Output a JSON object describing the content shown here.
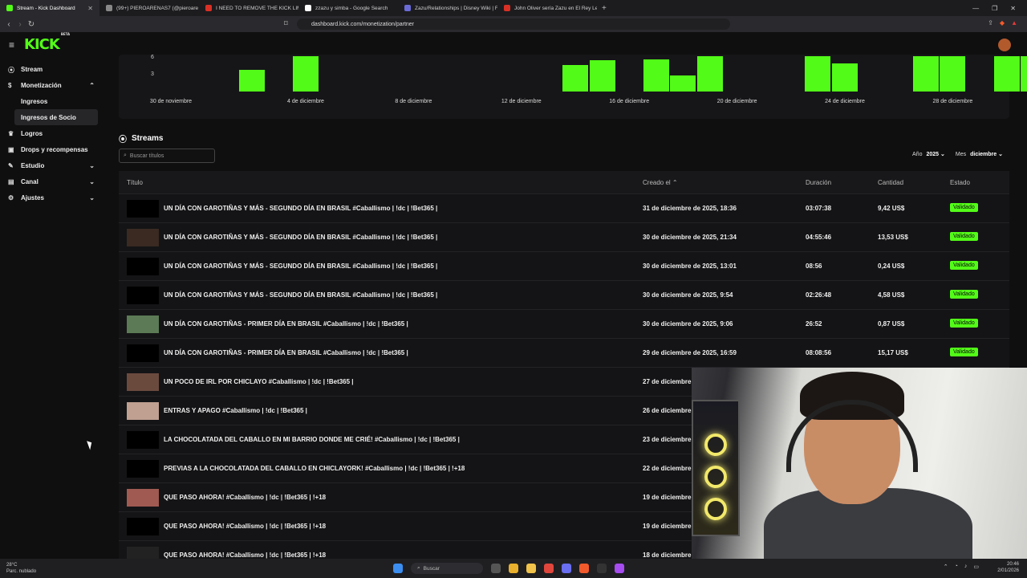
{
  "browser": {
    "tabs": [
      {
        "label": "Stream - Kick Dashboard",
        "color": "#53fc18",
        "active": true
      },
      {
        "label": "(99+) PIEROARENAS7 (@pieroare",
        "color": "#888888"
      },
      {
        "label": "I NEED TO REMOVE THE KICK LIMITI",
        "color": "#d93025"
      },
      {
        "label": "zzazu y simba - Google Search",
        "color": "#ffffff"
      },
      {
        "label": "Zazu/Relationships | Disney Wiki | Fa",
        "color": "#6b6bd6"
      },
      {
        "label": "John Oliver sería Zazu en El Rey León",
        "color": "#d93025"
      }
    ],
    "new_tab": "+",
    "url": "dashboard.kick.com/monetization/partner"
  },
  "brand": {
    "logo": "KICK",
    "beta": "BETA"
  },
  "sidebar": {
    "items": [
      {
        "label": "Stream",
        "icon": "broadcast-icon"
      },
      {
        "label": "Monetización",
        "icon": "dollar-icon",
        "expanded": true
      },
      {
        "label": "Logros",
        "icon": "trophy-icon"
      },
      {
        "label": "Drops y recompensas",
        "icon": "gift-icon"
      },
      {
        "label": "Estudio",
        "icon": "pencil-icon"
      },
      {
        "label": "Canal",
        "icon": "channel-icon"
      },
      {
        "label": "Ajustes",
        "icon": "gear-icon"
      }
    ],
    "sub_items": [
      {
        "label": "Ingresos"
      },
      {
        "label": "Ingresos de Socio",
        "active": true
      }
    ]
  },
  "chart_data": {
    "type": "bar",
    "y_ticks": [
      "6",
      "3"
    ],
    "x_labels": [
      "30 de noviembre",
      "4 de diciembre",
      "8 de diciembre",
      "12 de diciembre",
      "16 de diciembre",
      "20 de diciembre",
      "24 de diciembre",
      "28 de diciembre"
    ],
    "bar_color": "#53fc18",
    "bars": [
      {
        "x": "2 de diciembre",
        "value": 4
      },
      {
        "x": "4 de diciembre",
        "value": 6.5
      },
      {
        "x": "14 de diciembre",
        "value": 5
      },
      {
        "x": "15 de diciembre",
        "value": 5.8
      },
      {
        "x": "17 de diciembre",
        "value": 6
      },
      {
        "x": "18 de diciembre",
        "value": 3
      },
      {
        "x": "19 de diciembre",
        "value": 6.5
      },
      {
        "x": "23 de diciembre",
        "value": 6.5
      },
      {
        "x": "24 de diciembre",
        "value": 5.2
      },
      {
        "x": "27 de diciembre",
        "value": 6.5
      },
      {
        "x": "28 de diciembre",
        "value": 6.5
      },
      {
        "x": "30 de diciembre",
        "value": 6.5
      },
      {
        "x": "31 de diciembre",
        "value": 6.5
      }
    ]
  },
  "streams": {
    "title": "Streams",
    "search_placeholder": "Buscar títulos",
    "year_label": "Año",
    "year_value": "2025",
    "month_label": "Mes",
    "month_value": "diciembre",
    "columns": {
      "title": "Título",
      "created": "Creado el",
      "duration": "Duración",
      "amount": "Cantidad",
      "status": "Estado"
    },
    "rows": [
      {
        "title": "UN DÍA CON GAROTIÑAS Y MÁS - SEGUNDO DÍA EN BRASIL #Caballismo | !dc | !Bet365 |",
        "created": "31 de diciembre de 2025, 18:36",
        "duration": "03:07:38",
        "amount": "9,42 US$",
        "status": "Validado"
      },
      {
        "title": "UN DÍA CON GAROTIÑAS Y MÁS - SEGUNDO DÍA EN BRASIL #Caballismo | !dc | !Bet365 |",
        "created": "30 de diciembre de 2025, 21:34",
        "duration": "04:55:46",
        "amount": "13,53 US$",
        "status": "Validado"
      },
      {
        "title": "UN DÍA CON GAROTIÑAS Y MÁS - SEGUNDO DÍA EN BRASIL #Caballismo | !dc | !Bet365 |",
        "created": "30 de diciembre de 2025, 13:01",
        "duration": "08:56",
        "amount": "0,24 US$",
        "status": "Validado"
      },
      {
        "title": "UN DÍA CON GAROTIÑAS Y MÁS - SEGUNDO DÍA EN BRASIL #Caballismo | !dc | !Bet365 |",
        "created": "30 de diciembre de 2025, 9:54",
        "duration": "02:26:48",
        "amount": "4,58 US$",
        "status": "Validado"
      },
      {
        "title": "UN DÍA CON GAROTIÑAS - PRIMER DÍA EN BRASIL #Caballismo | !dc | !Bet365 |",
        "created": "30 de diciembre de 2025, 9:06",
        "duration": "26:52",
        "amount": "0,87 US$",
        "status": "Validado"
      },
      {
        "title": "UN DÍA CON GAROTIÑAS - PRIMER DÍA EN BRASIL #Caballismo | !dc | !Bet365 |",
        "created": "29 de diciembre de 2025, 16:59",
        "duration": "08:08:56",
        "amount": "15,17 US$",
        "status": "Validado"
      },
      {
        "title": "UN POCO DE IRL POR CHICLAYO #Caballismo | !dc | !Bet365 |",
        "created": "27 de diciembre",
        "duration": "",
        "amount": "",
        "status": ""
      },
      {
        "title": "ENTRAS Y APAGO #Caballismo | !dc | !Bet365 |",
        "created": "26 de diciembre",
        "duration": "",
        "amount": "",
        "status": ""
      },
      {
        "title": "LA CHOCOLATADA DEL CABALLO EN MI BARRIO DONDE ME CRIÉ! #Caballismo | !dc | !Bet365 |",
        "created": "23 de diciembre",
        "duration": "",
        "amount": "",
        "status": ""
      },
      {
        "title": "PREVIAS A LA CHOCOLATADA DEL CABALLO EN CHICLAYORK! #Caballismo | !dc | !Bet365 | !+18",
        "created": "22 de diciembre",
        "duration": "",
        "amount": "",
        "status": ""
      },
      {
        "title": "QUE PASO AHORA! #Caballismo | !dc | !Bet365 | !+18",
        "created": "19 de diciembre",
        "duration": "",
        "amount": "",
        "status": ""
      },
      {
        "title": "QUE PASO AHORA! #Caballismo | !dc | !Bet365 | !+18",
        "created": "19 de diciembre",
        "duration": "",
        "amount": "",
        "status": ""
      },
      {
        "title": "QUE PASO AHORA! #Caballismo | !dc | !Bet365 | !+18",
        "created": "18 de diciembre",
        "duration": "",
        "amount": "",
        "status": ""
      }
    ]
  },
  "taskbar": {
    "weather_temp": "28°C",
    "weather_desc": "Parc. nublado",
    "search_label": "Buscar",
    "time": "20:46",
    "date": "2/01/2026"
  }
}
